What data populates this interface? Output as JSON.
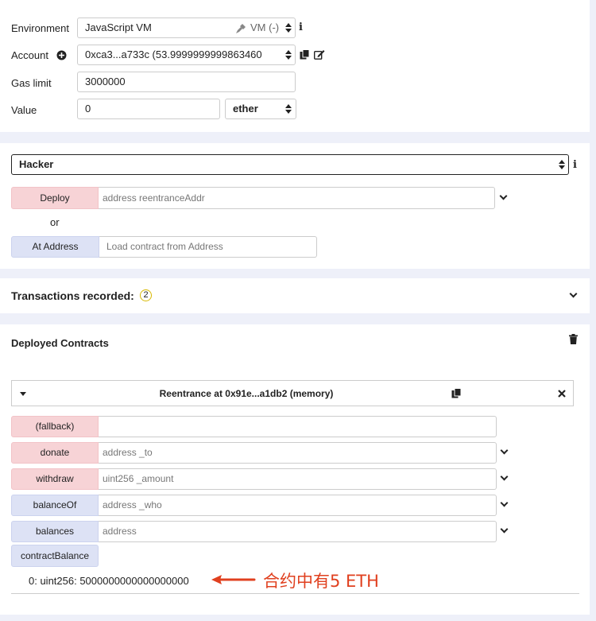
{
  "settings": {
    "environment_label": "Environment",
    "environment_value": "JavaScript VM",
    "vm_status": "VM (-)",
    "account_label": "Account",
    "account_value": "0xca3...a733c (53.9999999999863460",
    "gas_limit_label": "Gas limit",
    "gas_limit_value": "3000000",
    "value_label": "Value",
    "value_amount": "0",
    "value_unit": "ether"
  },
  "deploy": {
    "contract_selected": "Hacker",
    "deploy_label": "Deploy",
    "deploy_placeholder": "address reentranceAddr",
    "or_text": "or",
    "at_address_label": "At Address",
    "at_address_placeholder": "Load contract from Address"
  },
  "transactions": {
    "label": "Transactions recorded:",
    "count": "2"
  },
  "deployed": {
    "title": "Deployed Contracts",
    "instance_title": "Reentrance at 0x91e...a1db2 (memory)",
    "functions": [
      {
        "label": "(fallback)",
        "placeholder": "",
        "kind": "payable"
      },
      {
        "label": "donate",
        "placeholder": "address _to",
        "kind": "payable"
      },
      {
        "label": "withdraw",
        "placeholder": "uint256 _amount",
        "kind": "payable"
      },
      {
        "label": "balanceOf",
        "placeholder": "address _who",
        "kind": "view"
      },
      {
        "label": "balances",
        "placeholder": "address",
        "kind": "view"
      }
    ],
    "contract_balance_label": "contractBalance",
    "result": "0: uint256: 5000000000000000000"
  },
  "annotation": {
    "text": "合约中有5 ETH",
    "color": "#e0401f"
  },
  "colors": {
    "payable_button": "#f7d3d6",
    "view_button": "#dde2f5",
    "panel_background": "#eef0f9"
  }
}
